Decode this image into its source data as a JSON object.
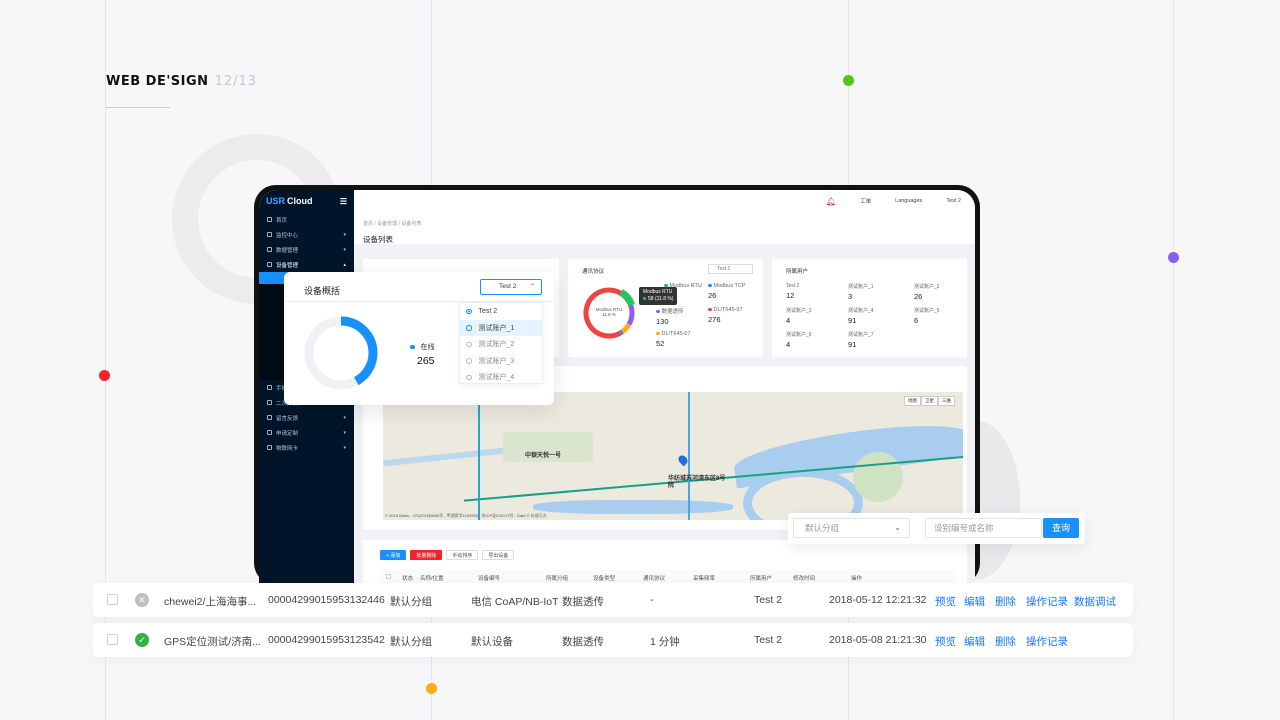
{
  "hero": {
    "title": "WEB DE'SIGN",
    "page": "12/13"
  },
  "colors": {
    "accent": "#1890ff",
    "green_dot": "#52c41a",
    "purple_dot": "#8b5cf6",
    "red_dot": "#f5222d",
    "orange_dot": "#faad14",
    "sidebar_bg": "#001529"
  },
  "app": {
    "logo_usr": "USR",
    "logo_cloud": "Cloud",
    "topbar": {
      "work": "工单",
      "languages": "Languages",
      "user": "Test 2"
    },
    "breadcrumb": "首页  /  设备管理  /  设备列表",
    "page_title": "设备列表",
    "sidebar": {
      "items": [
        {
          "label": "首页",
          "caret": ""
        },
        {
          "label": "监控中心",
          "caret": "▾"
        },
        {
          "label": "数据管理",
          "caret": "▾"
        },
        {
          "label": "设备管理",
          "caret": "▴"
        },
        {
          "label": "手机端",
          "caret": "▾"
        },
        {
          "label": "二次开发",
          "caret": "▾"
        },
        {
          "label": "留言反馈",
          "caret": "▾"
        },
        {
          "label": "申请定制",
          "caret": "▾"
        },
        {
          "label": "物联网卡",
          "caret": "▾"
        }
      ]
    },
    "protocol_card": {
      "title": "通讯协议",
      "select": "Test 2",
      "donut_label": "Modbus RTU",
      "donut_pct": "11.8 %",
      "tooltip_title": "Modbus RTU",
      "tooltip_value": "58 (11.8 %)",
      "items": [
        {
          "name": "Modbus RTU",
          "value": "",
          "color": "#22c55e"
        },
        {
          "name": "Modbus TCP",
          "value": "26",
          "color": "#1890ff"
        },
        {
          "name": "数据透传",
          "value": "130",
          "color": "#8b5cf6"
        },
        {
          "name": "DL/T645-97",
          "value": "276",
          "color": "#ef4444"
        },
        {
          "name": "DL/T645-07",
          "value": "52",
          "color": "#faad14"
        }
      ]
    },
    "users_card": {
      "title": "所属用户",
      "items": [
        {
          "name": "Test 2",
          "value": "12"
        },
        {
          "name": "测试账户_1",
          "value": "3"
        },
        {
          "name": "测试账户_2",
          "value": "26"
        },
        {
          "name": "测试账户_3",
          "value": "4"
        },
        {
          "name": "测试账户_4",
          "value": "91"
        },
        {
          "name": "测试账户_5",
          "value": "6"
        },
        {
          "name": "测试账户_6",
          "value": "4"
        },
        {
          "name": "测试账户_7",
          "value": "91"
        }
      ]
    },
    "map": {
      "ctl_map": "地图",
      "ctl_sat": "卫星",
      "ctl_3d": "三维",
      "label_1": "中银天悦一号",
      "label_2": "华纺城苏河湾东区8号院",
      "copyright": "© 2018 Baidu - GS(2018)5889号 - 甲测资字1100930 - 京ICP证030173号 - Data © 长地万方"
    },
    "buttons": {
      "add": "+ 添加",
      "batch_delete": "批量删除",
      "manual_sort": "手动排序",
      "export": "导出设备"
    },
    "table_head": [
      "状态",
      "名称/位置",
      "设备编号",
      "所属分组",
      "设备类型",
      "通讯协议",
      "采集频率",
      "所属用户",
      "修改时间",
      "操作"
    ]
  },
  "overview": {
    "title": "设备概括",
    "select": "Test 2",
    "chevron": "⌃",
    "options": [
      "Test 2",
      "测试账户_1",
      "测试账户_2",
      "测试账户_3",
      "测试账户_4"
    ],
    "legend": "在线",
    "value": "265",
    "online_ratio": 0.42
  },
  "search": {
    "group_placeholder": "默认分组",
    "input_placeholder": "设别编号或名称",
    "button": "查询"
  },
  "rows": [
    {
      "status": "offline",
      "name": "chewei2/上海海事...",
      "id": "00004299015953132446",
      "group": "默认分组",
      "type": "电信 CoAP/NB-IoT",
      "protocol": "数据透传",
      "freq": "-",
      "user": "Test 2",
      "time": "2018-05-12 12:21:32",
      "actions": [
        "预览",
        "编辑",
        "删除",
        "操作记录",
        "数据调试"
      ]
    },
    {
      "status": "online",
      "name": "GPS定位测试/济南...",
      "id": "00004299015953123542",
      "group": "默认分组",
      "type": "默认设备",
      "protocol": "数据透传",
      "freq": "1 分钟",
      "user": "Test 2",
      "time": "2018-05-08 21:21:30",
      "actions": [
        "预览",
        "编辑",
        "删除",
        "操作记录"
      ]
    }
  ]
}
